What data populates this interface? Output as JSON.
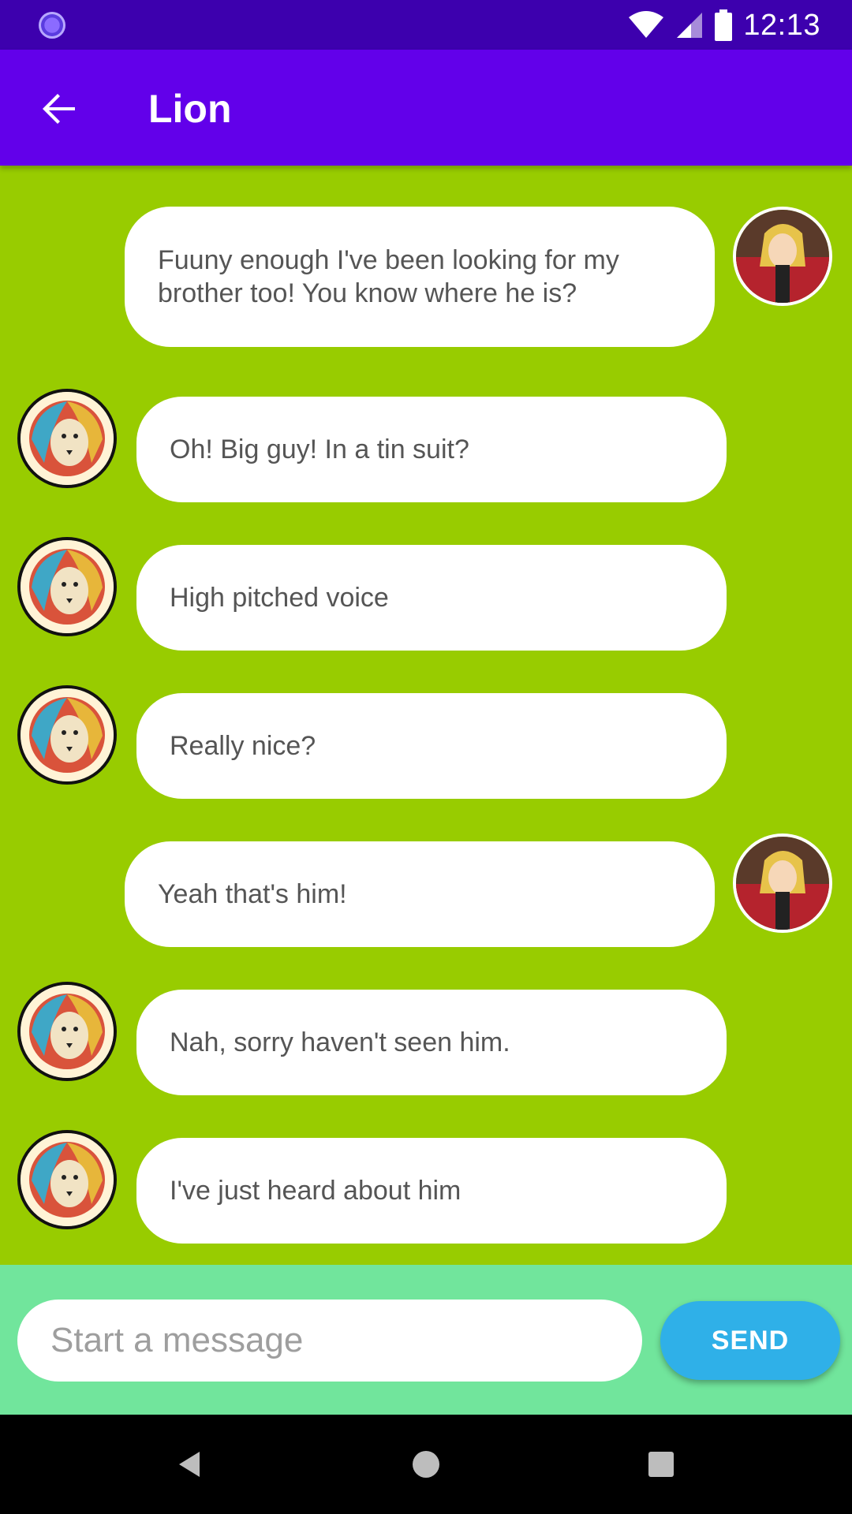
{
  "status_bar": {
    "time": "12:13",
    "icons": [
      "sync-icon",
      "wifi-icon",
      "signal-icon",
      "battery-icon"
    ]
  },
  "app_bar": {
    "title": "Lion",
    "back_icon": "arrow-left-icon"
  },
  "messages": [
    {
      "sender": "me",
      "text": "Fuuny enough I've been looking for my brother too! You know where he is?"
    },
    {
      "sender": "lion",
      "text": "Oh! Big guy! In a tin suit?"
    },
    {
      "sender": "lion",
      "text": "High pitched voice"
    },
    {
      "sender": "lion",
      "text": "Really nice?"
    },
    {
      "sender": "me",
      "text": "Yeah that's him!"
    },
    {
      "sender": "lion",
      "text": "Nah, sorry haven't seen him."
    },
    {
      "sender": "lion",
      "text": "I've just heard about him"
    }
  ],
  "composer": {
    "placeholder": "Start a message",
    "value": "",
    "send_label": "SEND"
  },
  "nav_bar": {
    "icons": [
      "back-triangle-icon",
      "home-circle-icon",
      "recents-square-icon"
    ]
  },
  "colors": {
    "status_bar": "#3D00AE",
    "app_bar": "#6200EA",
    "chat_background": "#98CC00",
    "input_bar": "#71E59C",
    "send_button": "#2FB0E8",
    "bubble": "#FFFFFF"
  }
}
